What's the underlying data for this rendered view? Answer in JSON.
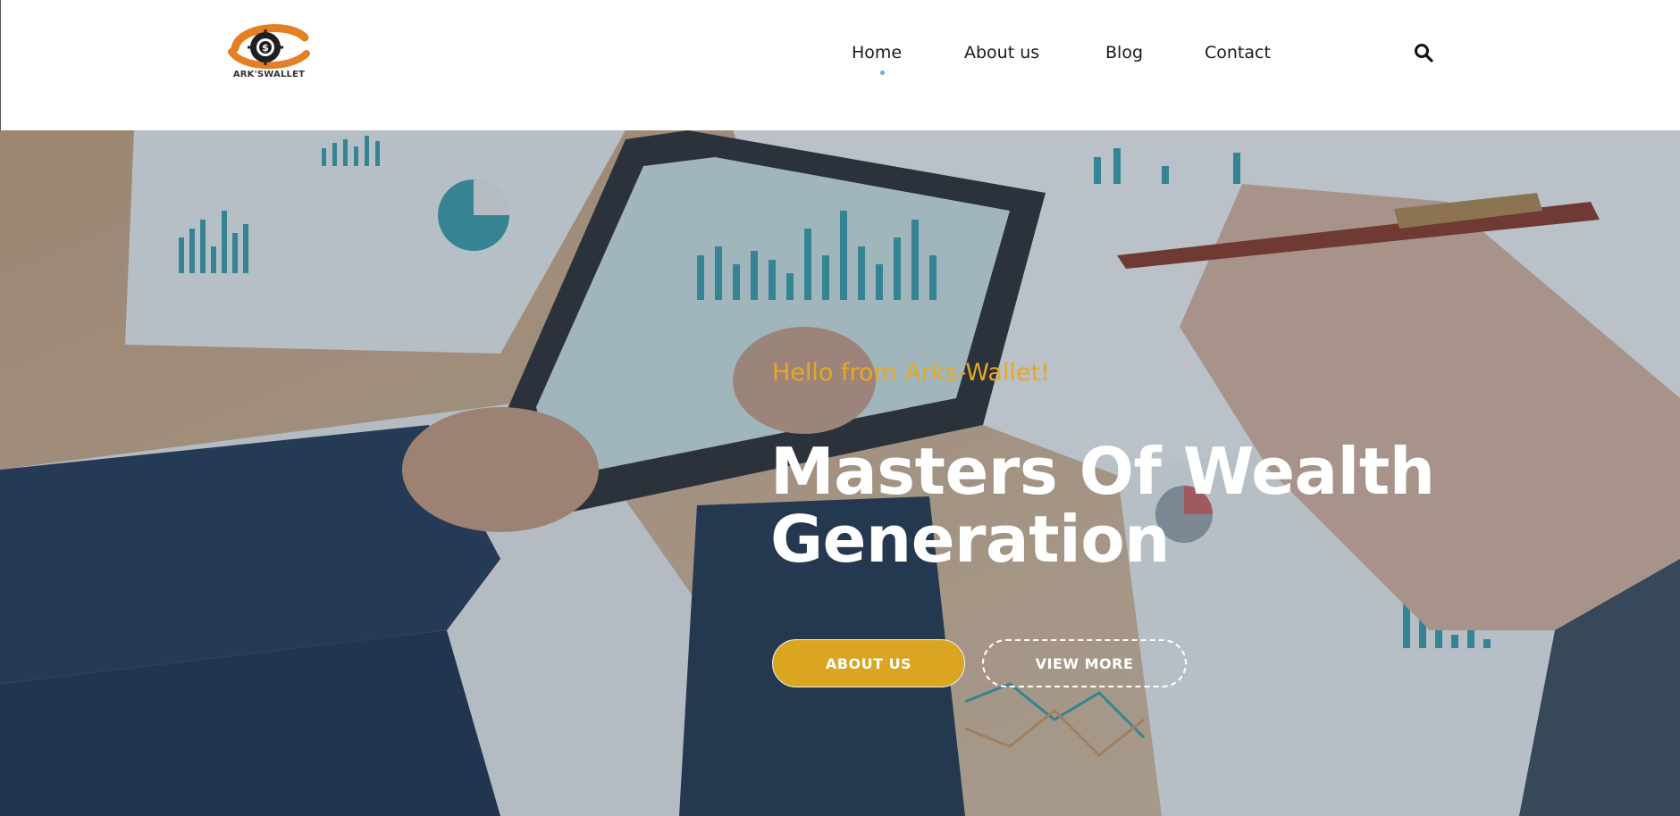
{
  "header": {
    "logo_text": "ARK'SWALLET",
    "nav": [
      {
        "label": "Home",
        "active": true
      },
      {
        "label": "About us",
        "active": false
      },
      {
        "label": "Blog",
        "active": false
      },
      {
        "label": "Contact",
        "active": false
      }
    ],
    "search_icon": "search-icon",
    "active_indicator_color": "#5fb7d6"
  },
  "hero": {
    "kicker": "Hello from Arks-Wallet!",
    "title_line1": "Masters Of Wealth",
    "title_line2": "Generation",
    "primary_button": "ABOUT US",
    "secondary_button": "VIEW MORE"
  },
  "colors": {
    "brand_orange": "#e67e22",
    "accent_gold": "#daa520",
    "kicker_gold": "#e6a823"
  }
}
